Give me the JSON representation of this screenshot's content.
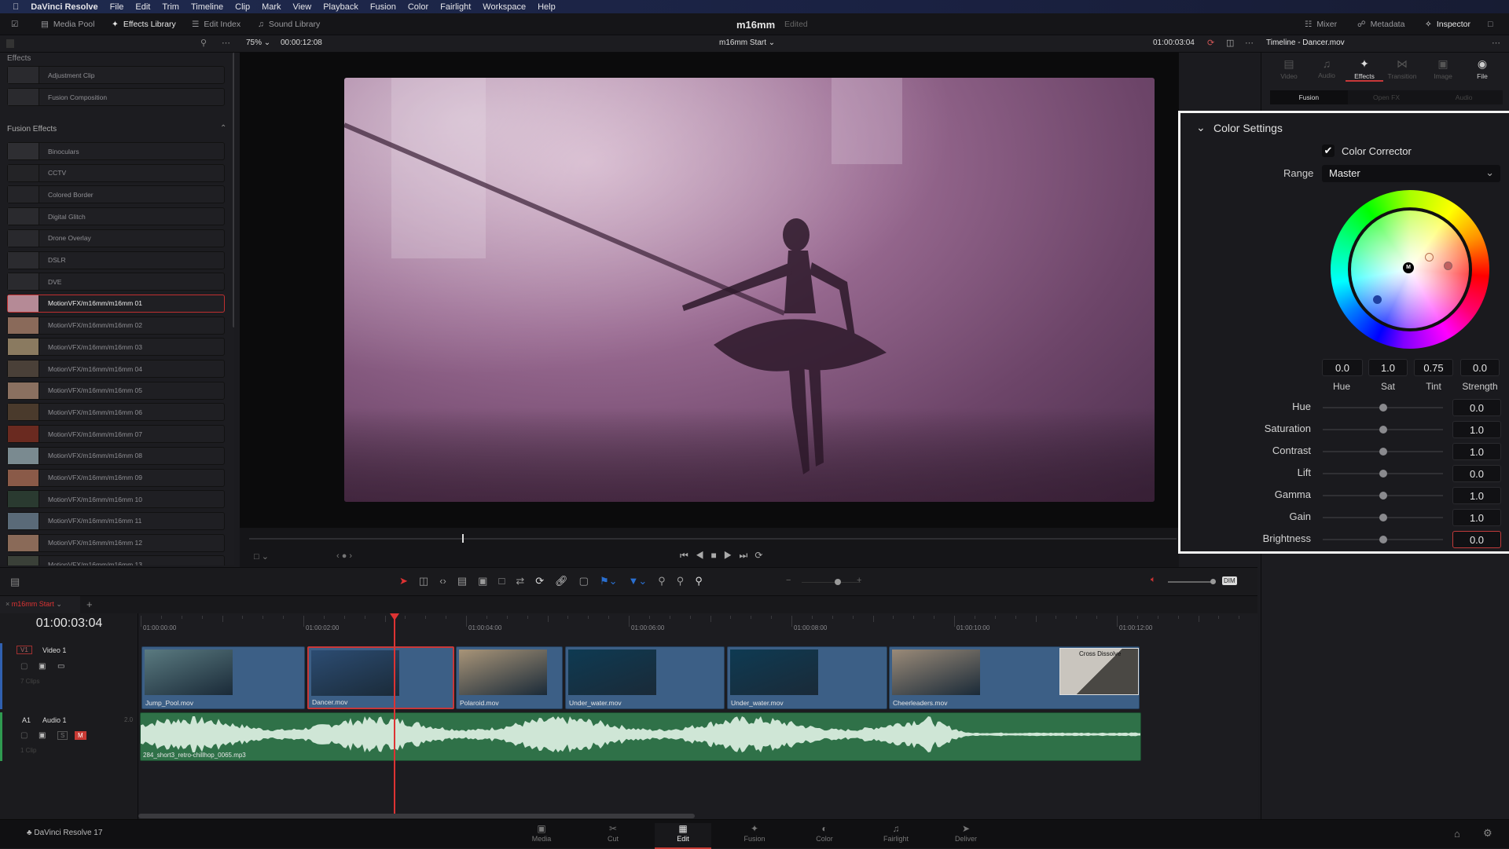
{
  "menubar": {
    "app": "DaVinci Resolve",
    "items": [
      "File",
      "Edit",
      "Trim",
      "Timeline",
      "Clip",
      "Mark",
      "View",
      "Playback",
      "Fusion",
      "Color",
      "Fairlight",
      "Workspace",
      "Help"
    ]
  },
  "toolbar": {
    "media_pool": "Media Pool",
    "effects_library": "Effects Library",
    "edit_index": "Edit Index",
    "sound_library": "Sound Library",
    "project_title": "m16mm",
    "project_status": "Edited",
    "mixer": "Mixer",
    "metadata": "Metadata",
    "inspector": "Inspector"
  },
  "viewer": {
    "zoom": "75%",
    "duration": "00:00:12:08",
    "timeline_name": "m16mm Start",
    "timecode": "01:00:03:04",
    "playhead_fraction": 0.23
  },
  "inspector": {
    "title": "Timeline - Dancer.mov",
    "tabs": [
      "Video",
      "Audio",
      "Effects",
      "Transition",
      "Image",
      "File"
    ],
    "active_tab": "Effects",
    "subtabs": [
      "Fusion",
      "Open FX",
      "Audio"
    ],
    "active_subtab": "Fusion"
  },
  "effects": {
    "section_top": "Effects",
    "top_items": [
      "Adjustment Clip",
      "Fusion Composition"
    ],
    "fusion_header": "Fusion Effects",
    "fusion_items": [
      "Binoculars",
      "CCTV",
      "Colored Border",
      "Digital Glitch",
      "Drone Overlay",
      "DSLR",
      "DVE",
      "MotionVFX/m16mm/m16mm 01",
      "MotionVFX/m16mm/m16mm 02",
      "MotionVFX/m16mm/m16mm 03",
      "MotionVFX/m16mm/m16mm 04",
      "MotionVFX/m16mm/m16mm 05",
      "MotionVFX/m16mm/m16mm 06",
      "MotionVFX/m16mm/m16mm 07",
      "MotionVFX/m16mm/m16mm 08",
      "MotionVFX/m16mm/m16mm 09",
      "MotionVFX/m16mm/m16mm 10",
      "MotionVFX/m16mm/m16mm 11",
      "MotionVFX/m16mm/m16mm 12",
      "MotionVFX/m16mm/m16mm 13"
    ],
    "selected": "MotionVFX/m16mm/m16mm 01"
  },
  "color_settings": {
    "title": "Color Settings",
    "color_corrector_label": "Color Corrector",
    "color_corrector_checked": true,
    "range_label": "Range",
    "range_value": "Master",
    "wheel_values": [
      {
        "label": "Hue",
        "value": "0.0"
      },
      {
        "label": "Sat",
        "value": "1.0"
      },
      {
        "label": "Tint",
        "value": "0.75"
      },
      {
        "label": "Strength",
        "value": "0.0"
      }
    ],
    "sliders": [
      {
        "label": "Hue",
        "value": "0.0"
      },
      {
        "label": "Saturation",
        "value": "1.0"
      },
      {
        "label": "Contrast",
        "value": "1.0"
      },
      {
        "label": "Lift",
        "value": "0.0"
      },
      {
        "label": "Gamma",
        "value": "1.0"
      },
      {
        "label": "Gain",
        "value": "1.0"
      },
      {
        "label": "Brightness",
        "value": "0.0"
      }
    ],
    "wheel_center_label": "M",
    "focused_field": "Brightness"
  },
  "timeline": {
    "tab": "m16mm Start",
    "timecode": "01:00:03:04",
    "ruler": [
      "01:00:00:00",
      "01:00:02:00",
      "01:00:04:00",
      "01:00:06:00",
      "01:00:08:00",
      "01:00:10:00",
      "01:00:12:00"
    ],
    "video_track": {
      "id": "V1",
      "name": "Video 1",
      "count": "7 Clips"
    },
    "audio_track": {
      "id": "A1",
      "name": "Audio 1",
      "channels": "2.0",
      "count": "1 Clip",
      "solo": "S",
      "mute": "M"
    },
    "clips": [
      "Jump_Pool.mov",
      "Dancer.mov",
      "Polaroid.mov",
      "Under_water.mov",
      "Under_water.mov",
      "Cheerleaders.mov"
    ],
    "transition": "Cross Dissolve",
    "audio_clip": "284_short3_retro-chillhop_0065.mp3",
    "dim": "DIM"
  },
  "bottom": {
    "app_version": "DaVinci Resolve 17",
    "pages": [
      "Media",
      "Cut",
      "Edit",
      "Fusion",
      "Color",
      "Fairlight",
      "Deliver"
    ],
    "active_page": "Edit"
  },
  "colors": {
    "accent": "#c8383a",
    "clip": "#3c5f86",
    "audio": "#2f7148"
  }
}
